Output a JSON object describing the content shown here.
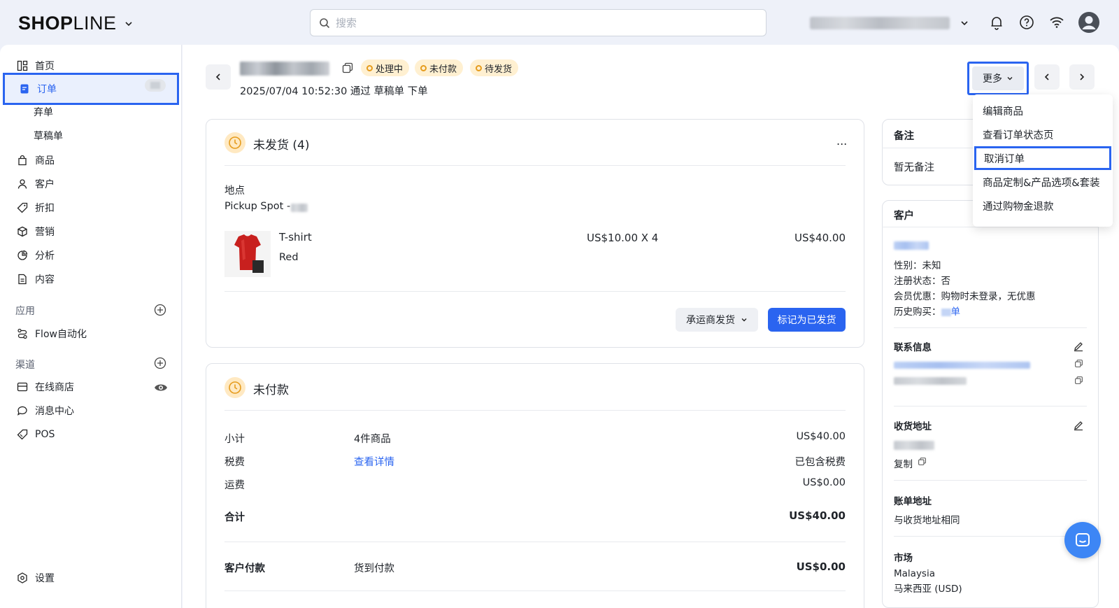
{
  "header": {
    "logo_bold": "SHOP",
    "logo_thin": "LINE",
    "search_placeholder": "搜索"
  },
  "sidebar": {
    "items": [
      {
        "label": "首页"
      },
      {
        "label": "订单"
      },
      {
        "label": "弃单"
      },
      {
        "label": "草稿单"
      },
      {
        "label": "商品"
      },
      {
        "label": "客户"
      },
      {
        "label": "折扣"
      },
      {
        "label": "营销"
      },
      {
        "label": "分析"
      },
      {
        "label": "内容"
      }
    ],
    "apps_label": "应用",
    "apps_items": [
      {
        "label": "Flow自动化"
      }
    ],
    "channels_label": "渠道",
    "channel_items": [
      {
        "label": "在线商店"
      },
      {
        "label": "消息中心"
      },
      {
        "label": "POS"
      }
    ],
    "settings_label": "设置"
  },
  "order": {
    "badges": [
      "处理中",
      "未付款",
      "待发货"
    ],
    "timestamp": "2025/07/04 10:52:30",
    "via_text": "通过 草稿单 下单",
    "more_label": "更多",
    "more_menu": [
      "编辑商品",
      "查看订单状态页",
      "取消订单",
      "商品定制&产品选项&套装",
      "通过购物金退款"
    ]
  },
  "fulfillment": {
    "title": "未发货 (4)",
    "ellipsis": "...",
    "location_label": "地点",
    "location_value": "Pickup Spot -",
    "product_name": "T-shirt",
    "product_variant": "Red",
    "unit_price": "US$10.00 X 4",
    "line_total": "US$40.00",
    "carrier_button": "承运商发货",
    "mark_button": "标记为已发货"
  },
  "payment": {
    "title": "未付款",
    "rows": [
      {
        "label": "小计",
        "middle": "4件商品",
        "value": "US$40.00"
      },
      {
        "label": "税费",
        "middle": "查看详情",
        "value": "已包含税费"
      },
      {
        "label": "运费",
        "middle": "",
        "value": "US$0.00"
      },
      {
        "label": "合计",
        "middle": "",
        "value": "US$40.00"
      },
      {
        "label": "客户付款",
        "middle": "货到付款",
        "value": "US$0.00"
      }
    ]
  },
  "notes": {
    "title": "备注",
    "empty": "暂无备注"
  },
  "customer": {
    "title": "客户",
    "gender": "性别：未知",
    "registered": "注册状态：否",
    "member": "会员优惠：购物时未登录，无优惠",
    "history_prefix": "历史购买：",
    "history_suffix": "单",
    "contact_title": "联系信息",
    "shipping_title": "收货地址",
    "copy_label": "复制",
    "billing_title": "账单地址",
    "billing_value": "与收货地址相同",
    "market_title": "市场",
    "market_value_1": "Malaysia",
    "market_value_2": "马来西亚 (USD)"
  },
  "colors": {
    "accent": "#2a64f0",
    "badge_bg": "#fff0d1",
    "badge_dot": "#e59b1c"
  }
}
